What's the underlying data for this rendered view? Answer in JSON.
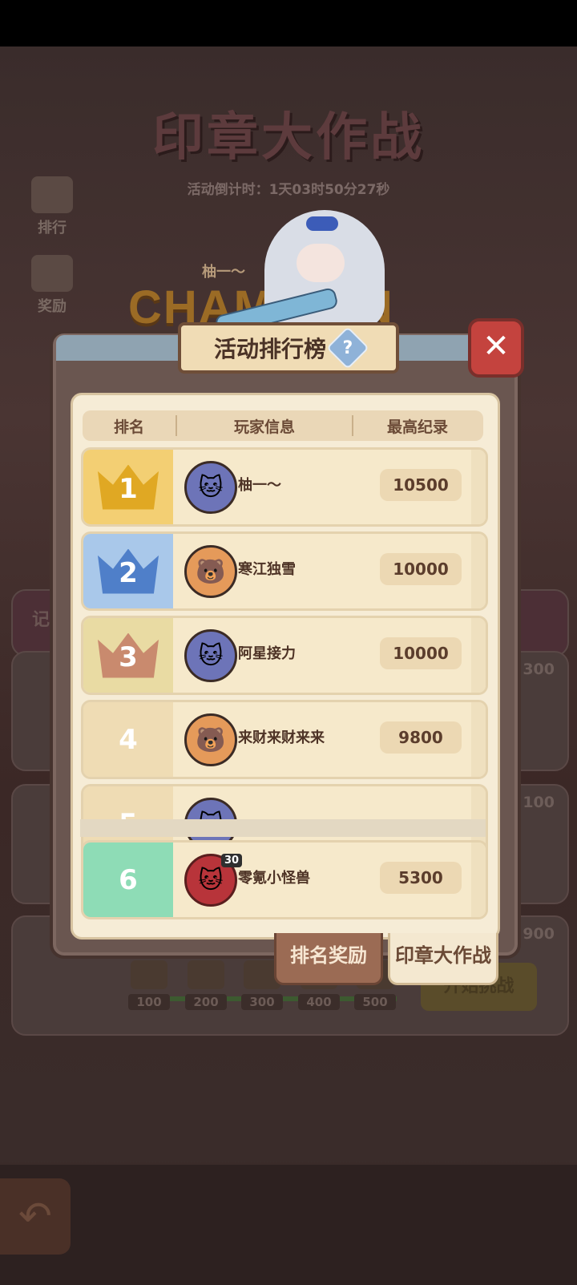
{
  "background": {
    "title": "印章大作战",
    "countdown": "活动倒计时：1天03时50分27秒",
    "side_buttons": [
      {
        "label": "排行",
        "icon": "trophy-icon"
      },
      {
        "label": "奖励",
        "icon": "gift-icon"
      }
    ],
    "champion_text": "CHAMPION",
    "champion_name": "柚一～",
    "record_tab_partial": "记",
    "card_values": [
      "300",
      "100",
      "900"
    ],
    "milestones": [
      "100",
      "200",
      "300",
      "400",
      "500"
    ],
    "start_button": "开始挑战"
  },
  "dialog": {
    "title": "活动排行榜",
    "help_symbol": "?",
    "close_symbol": "✕",
    "columns": [
      "排名",
      "玩家信息",
      "最高纪录"
    ],
    "rows": [
      {
        "rank": "1",
        "name": "柚一～",
        "score": "10500",
        "avatar": "cat-icon"
      },
      {
        "rank": "2",
        "name": "寒江独雪",
        "score": "10000",
        "avatar": "bear-icon"
      },
      {
        "rank": "3",
        "name": "阿星接力",
        "score": "10000",
        "avatar": "cat-icon"
      },
      {
        "rank": "4",
        "name": "来财来财来来",
        "score": "9800",
        "avatar": "bear-icon"
      },
      {
        "rank": "5",
        "name": "",
        "score": "",
        "avatar": "cat-icon"
      }
    ],
    "my_row": {
      "rank": "6",
      "name": "零氪小怪兽",
      "score": "5300",
      "level": "30",
      "avatar": "cat-icon"
    },
    "tabs": [
      "排名奖励",
      "印章大作战"
    ]
  },
  "colors": {
    "rank1": "#f3cf73",
    "rank2": "#a9c8ea",
    "rank3": "#e9dba3",
    "rank_other": "#efdcb4",
    "my_rank": "#8edcb6",
    "close": "#c4433e"
  }
}
